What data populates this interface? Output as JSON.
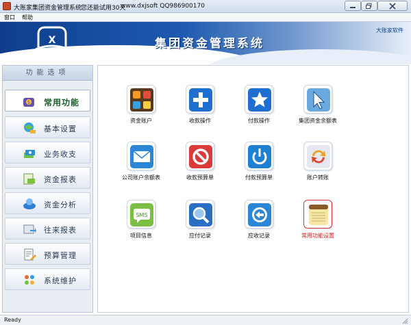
{
  "window": {
    "title": "大账家集团资金管理系统",
    "trial_notice": "您还能试用30天",
    "site_info": "www.dxjsoft QQ986900170"
  },
  "menu": {
    "items": [
      {
        "label": "窗口"
      },
      {
        "label": "帮助"
      }
    ]
  },
  "banner": {
    "title": "集团资金管理系统",
    "brand": "大账家软件"
  },
  "sidebar": {
    "header": "功能选项",
    "items": [
      {
        "label": "常用功能",
        "icon": "coin-bag-icon",
        "active": true
      },
      {
        "label": "基本设置",
        "icon": "globe-settings-icon",
        "active": false
      },
      {
        "label": "业务收支",
        "icon": "money-stack-icon",
        "active": false
      },
      {
        "label": "资金报表",
        "icon": "report-cash-icon",
        "active": false
      },
      {
        "label": "资金分析",
        "icon": "analysis-globe-icon",
        "active": false
      },
      {
        "label": "往来报表",
        "icon": "transfer-report-icon",
        "active": false
      },
      {
        "label": "预算管理",
        "icon": "budget-document-icon",
        "active": false
      },
      {
        "label": "系统维护",
        "icon": "system-maintenance-icon",
        "active": false
      }
    ]
  },
  "functions": {
    "tiles": [
      {
        "label": "资金账户",
        "icon": "app-grid-icon"
      },
      {
        "label": "收款操作",
        "icon": "plus-icon"
      },
      {
        "label": "付款操作",
        "icon": "star-icon"
      },
      {
        "label": "集团资金余额表",
        "icon": "cursor-arrow-icon"
      },
      {
        "label": "公司账户余额表",
        "icon": "mail-icon"
      },
      {
        "label": "收款预算单",
        "icon": "no-entry-icon"
      },
      {
        "label": "付款预算单",
        "icon": "power-icon"
      },
      {
        "label": "账户转账",
        "icon": "sync-arrows-icon"
      },
      {
        "label": "项目信息",
        "icon": "sms-icon"
      },
      {
        "label": "应付记录",
        "icon": "magnifier-icon"
      },
      {
        "label": "应收记录",
        "icon": "back-arrow-icon"
      },
      {
        "label": "常用功能设置",
        "icon": "notepad-icon",
        "highlight": true
      }
    ]
  },
  "status": {
    "text": "Ready"
  },
  "colors": {
    "banner_dark": "#0e3d8c",
    "highlight_red": "#d01c1c",
    "active_green": "#1b5e2a"
  }
}
